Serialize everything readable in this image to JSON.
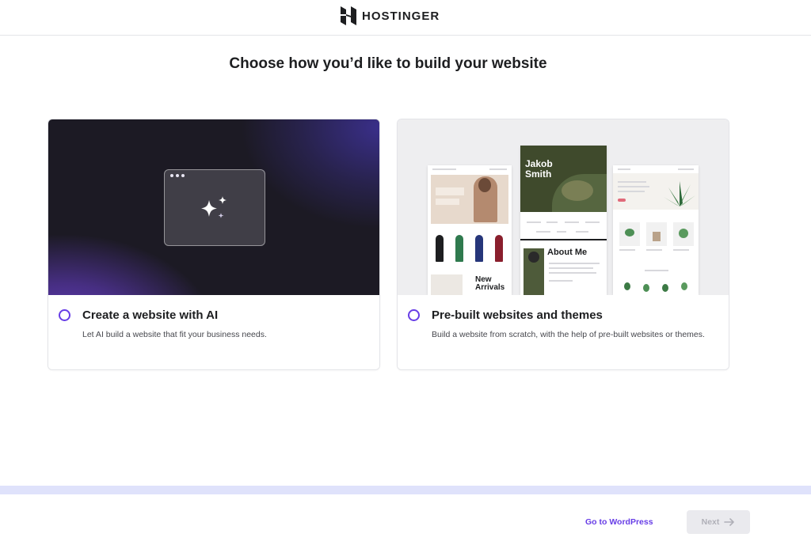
{
  "header": {
    "brand": "HOSTINGER"
  },
  "page_title": "Choose how you’d like to build your website",
  "options": [
    {
      "title": "Create a website with AI",
      "description": "Let AI build a website that fit your business needs."
    },
    {
      "title": "Pre-built websites and themes",
      "description": "Build a website from scratch, with the help of pre-built websites or themes.",
      "preview": {
        "center_name": "Jakob Smith",
        "center_heading": "About Me",
        "left_heading": "New Arrivals"
      }
    }
  ],
  "footer": {
    "wordpress_link": "Go to WordPress",
    "next_label": "Next"
  },
  "colors": {
    "accent": "#673de6",
    "footer_band": "#dfe2fb"
  }
}
